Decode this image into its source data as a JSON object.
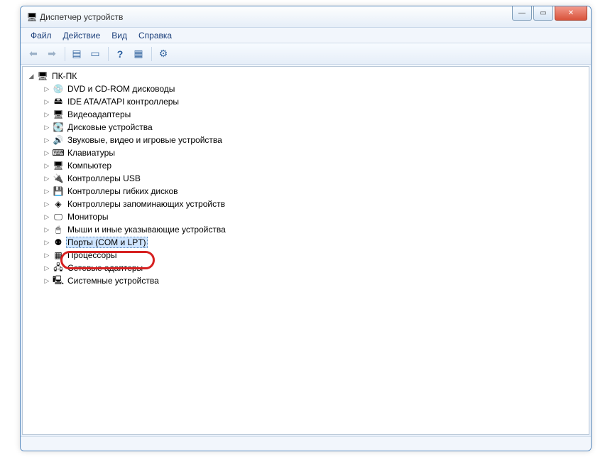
{
  "window": {
    "title": "Диспетчер устройств"
  },
  "menubar": {
    "file": "Файл",
    "action": "Действие",
    "view": "Вид",
    "help": "Справка"
  },
  "tree": {
    "root": "ПК-ПК",
    "items": [
      {
        "label": "DVD и CD-ROM дисководы",
        "icon": "💿"
      },
      {
        "label": "IDE ATA/ATAPI контроллеры",
        "icon": "🖴"
      },
      {
        "label": "Видеоадаптеры",
        "icon": "🖥"
      },
      {
        "label": "Дисковые устройства",
        "icon": "💽"
      },
      {
        "label": "Звуковые, видео и игровые устройства",
        "icon": "🔊"
      },
      {
        "label": "Клавиатуры",
        "icon": "⌨"
      },
      {
        "label": "Компьютер",
        "icon": "🖥"
      },
      {
        "label": "Контроллеры USB",
        "icon": "🔌"
      },
      {
        "label": "Контроллеры гибких дисков",
        "icon": "💾"
      },
      {
        "label": "Контроллеры запоминающих устройств",
        "icon": "◈"
      },
      {
        "label": "Мониторы",
        "icon": "🖵"
      },
      {
        "label": "Мыши и иные указывающие устройства",
        "icon": "🖱"
      },
      {
        "label": "Порты (COM и LPT)",
        "icon": "⚉",
        "selected": true
      },
      {
        "label": "Процессоры",
        "icon": "▦"
      },
      {
        "label": "Сетевые адаптеры",
        "icon": "🖧"
      },
      {
        "label": "Системные устройства",
        "icon": "🖳"
      }
    ]
  }
}
